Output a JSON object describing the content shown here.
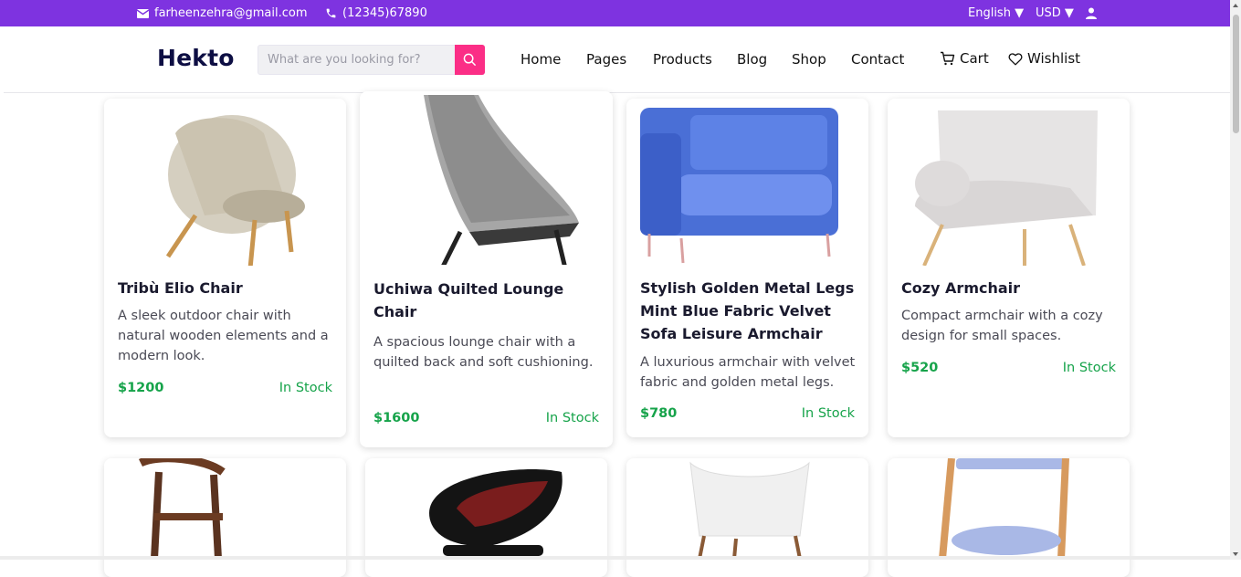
{
  "topbar": {
    "email": "farheenzehra@gmail.com",
    "phone": "(12345)67890",
    "language": "English ▼",
    "currency": "USD ▼",
    "bg": "#7e33e0"
  },
  "header": {
    "logo": "Hekto",
    "search_placeholder": "What are you looking for?",
    "nav": [
      "Home",
      "Pages",
      "Products",
      "Blog",
      "Shop",
      "Contact"
    ],
    "cart": "Cart",
    "wishlist": "Wishlist"
  },
  "products": [
    {
      "title": "Tribù Elio Chair",
      "desc": "A sleek outdoor chair with natural wooden elements and a modern look.",
      "price": "$1200",
      "stock": "In Stock"
    },
    {
      "title": "Uchiwa Quilted Lounge Chair",
      "desc": "A spacious lounge chair with a quilted back and soft cushioning.",
      "price": "$1600",
      "stock": "In Stock"
    },
    {
      "title": "Stylish Golden Metal Legs Mint Blue Fabric Velvet Sofa Leisure Armchair",
      "desc": "A luxurious armchair with velvet fabric and golden metal legs.",
      "price": "$780",
      "stock": "In Stock"
    },
    {
      "title": "Cozy Armchair",
      "desc": "Compact armchair with a cozy design for small spaces.",
      "price": "$520",
      "stock": "In Stock"
    }
  ],
  "colors": {
    "accent": "#fb2e86",
    "price_green": "#16a34a",
    "logo_navy": "#0d0e43"
  }
}
